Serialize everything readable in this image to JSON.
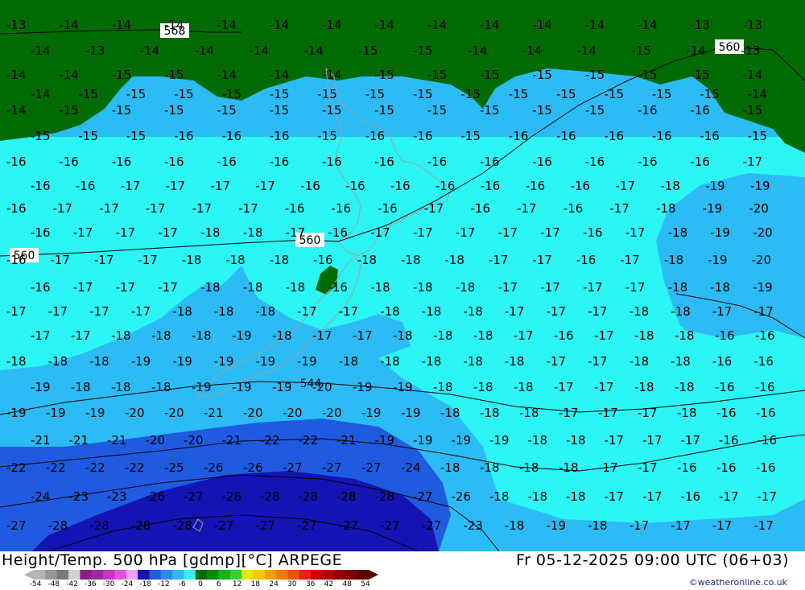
{
  "map": {
    "title": "Height/Temp. 500 hPa [gdmp][°C] ARPEGE",
    "valid_time": "Fr 05-12-2025 09:00 UTC (06+03)",
    "credit": "©weatheronline.co.uk",
    "colors": {
      "dark_green": "#036b03",
      "cyan": "#2cf5f5",
      "light_blue": "#2cbcf5",
      "mid_blue": "#1e5be0",
      "deep_blue": "#1414b4",
      "contour": "#000000",
      "coastline": "#a0a0a0"
    },
    "contour_labels": [
      "568",
      "560",
      "560",
      "560",
      "544"
    ],
    "temperature_labels": [
      "-13",
      "-14",
      "-14",
      "-14",
      "-14",
      "-14",
      "-14",
      "-14",
      "-14",
      "-14",
      "-14",
      "-14",
      "-14",
      "-13",
      "-13",
      "-14",
      "-13",
      "-14",
      "-14",
      "-14",
      "-14",
      "-15",
      "-15",
      "-14",
      "-14",
      "-14",
      "-15",
      "-14",
      "-13",
      "-14",
      "-14",
      "-15",
      "-15",
      "-14",
      "-14",
      "-14",
      "-15",
      "-15",
      "-15",
      "-15",
      "-15",
      "-15",
      "-15",
      "-14",
      "-14",
      "-15",
      "-15",
      "-15",
      "-15",
      "-15",
      "-15",
      "-15",
      "-15",
      "-15",
      "-15",
      "-15",
      "-15",
      "-15",
      "-15",
      "-14",
      "-14",
      "-15",
      "-15",
      "-15",
      "-15",
      "-15",
      "-15",
      "-15",
      "-15",
      "-15",
      "-15",
      "-15",
      "-16",
      "-16",
      "-15",
      "-15",
      "-15",
      "-15",
      "-16",
      "-16",
      "-16",
      "-15",
      "-16",
      "-16",
      "-15",
      "-16",
      "-16",
      "-16",
      "-16",
      "-16",
      "-15",
      "-16",
      "-16",
      "-16",
      "-16",
      "-16",
      "-16",
      "-16",
      "-16",
      "-16",
      "-16",
      "-16",
      "-16",
      "-16",
      "-16",
      "-17",
      "-16",
      "-16",
      "-17",
      "-17",
      "-17",
      "-17",
      "-16",
      "-16",
      "-16",
      "-16",
      "-16",
      "-16",
      "-16",
      "-17",
      "-18",
      "-19",
      "-19",
      "-16",
      "-17",
      "-17",
      "-17",
      "-17",
      "-17",
      "-16",
      "-16",
      "-16",
      "-17",
      "-16",
      "-17",
      "-16",
      "-17",
      "-18",
      "-19",
      "-20",
      "-16",
      "-17",
      "-17",
      "-17",
      "-18",
      "-18",
      "-17",
      "-16",
      "-17",
      "-17",
      "-17",
      "-17",
      "-17",
      "-16",
      "-17",
      "-18",
      "-19",
      "-20",
      "-16",
      "-17",
      "-17",
      "-17",
      "-18",
      "-18",
      "-18",
      "-16",
      "-18",
      "-18",
      "-18",
      "-17",
      "-17",
      "-16",
      "-17",
      "-18",
      "-19",
      "-20",
      "-16",
      "-17",
      "-17",
      "-17",
      "-18",
      "-18",
      "-18",
      "-16",
      "-18",
      "-18",
      "-18",
      "-17",
      "-17",
      "-17",
      "-17",
      "-18",
      "-18",
      "-19",
      "-17",
      "-17",
      "-17",
      "-17",
      "-18",
      "-18",
      "-18",
      "-17",
      "-17",
      "-18",
      "-18",
      "-18",
      "-17",
      "-17",
      "-17",
      "-18",
      "-18",
      "-17",
      "-17",
      "-17",
      "-17",
      "-18",
      "-18",
      "-18",
      "-19",
      "-18",
      "-17",
      "-17",
      "-18",
      "-18",
      "-18",
      "-17",
      "-16",
      "-17",
      "-18",
      "-18",
      "-16",
      "-16",
      "-18",
      "-18",
      "-18",
      "-19",
      "-19",
      "-19",
      "-19",
      "-19",
      "-18",
      "-18",
      "-18",
      "-18",
      "-18",
      "-17",
      "-17",
      "-18",
      "-18",
      "-16",
      "-16",
      "-19",
      "-18",
      "-18",
      "-18",
      "-19",
      "-19",
      "-19",
      "-20",
      "-19",
      "-19",
      "-18",
      "-18",
      "-18",
      "-17",
      "-17",
      "-18",
      "-18",
      "-16",
      "-16",
      "-19",
      "-19",
      "-19",
      "-20",
      "-20",
      "-21",
      "-20",
      "-20",
      "-20",
      "-19",
      "-19",
      "-18",
      "-18",
      "-18",
      "-17",
      "-17",
      "-17",
      "-18",
      "-16",
      "-16",
      "-21",
      "-21",
      "-21",
      "-20",
      "-20",
      "-21",
      "-22",
      "-22",
      "-21",
      "-19",
      "-19",
      "-19",
      "-19",
      "-18",
      "-18",
      "-17",
      "-17",
      "-17",
      "-16",
      "-16",
      "-22",
      "-22",
      "-22",
      "-22",
      "-25",
      "-26",
      "-26",
      "-27",
      "-27",
      "-27",
      "-24",
      "-18",
      "-18",
      "-18",
      "-18",
      "-17",
      "-17",
      "-16",
      "-16",
      "-16",
      "-24",
      "-23",
      "-23",
      "-26",
      "-27",
      "-28",
      "-28",
      "-28",
      "-28",
      "-28",
      "-27",
      "-26",
      "-18",
      "-18",
      "-18",
      "-17",
      "-17",
      "-16",
      "-17",
      "-17",
      "-27",
      "-28",
      "-28",
      "-28",
      "-28",
      "-27",
      "-27",
      "-27",
      "-27",
      "-27",
      "-27",
      "-23",
      "-18",
      "-19",
      "-18",
      "-17",
      "-17",
      "-17",
      "-17"
    ]
  },
  "colorbar": {
    "ticks": [
      "-54",
      "-48",
      "-42",
      "-36",
      "-30",
      "-24",
      "-18",
      "-12",
      "-6",
      "0",
      "6",
      "12",
      "18",
      "24",
      "30",
      "36",
      "42",
      "48",
      "54"
    ],
    "colors": [
      "#b4b4b4",
      "#969696",
      "#787878",
      "#d2d2d2",
      "#8c1e8c",
      "#a028a0",
      "#c832c8",
      "#e150e1",
      "#f0a0f0",
      "#1414b4",
      "#1e5be0",
      "#2c88f0",
      "#2cbcf5",
      "#2cf5f5",
      "#036b03",
      "#0a8c0a",
      "#14b414",
      "#32d232",
      "#e6e600",
      "#f5c800",
      "#f5a000",
      "#f57800",
      "#f05000",
      "#e61e1e",
      "#d20000",
      "#b40000",
      "#960000",
      "#780000",
      "#5a0000"
    ]
  }
}
